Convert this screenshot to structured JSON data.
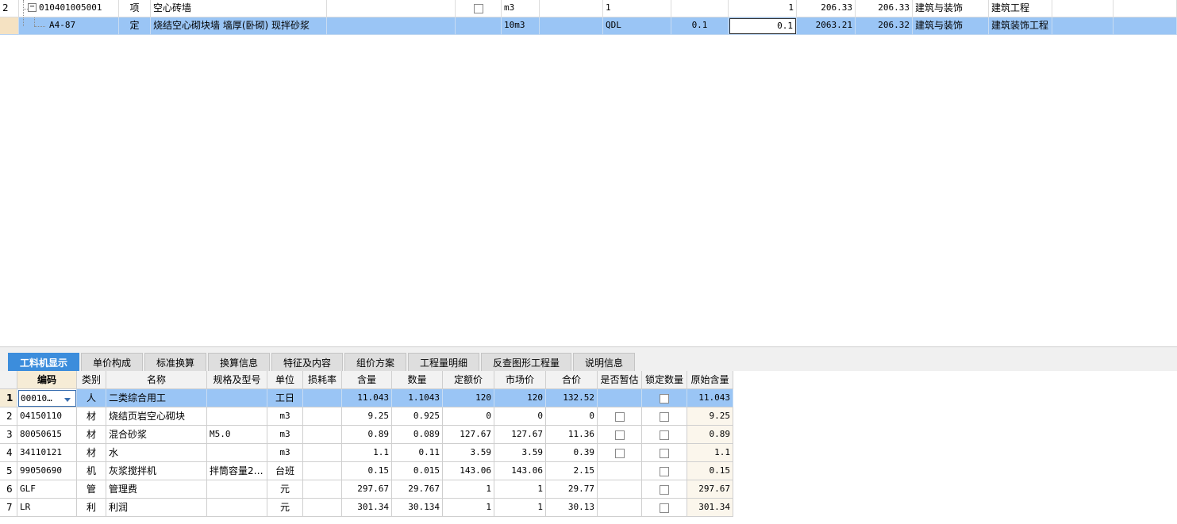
{
  "top_rows": [
    {
      "num": "2",
      "expand_sym": "−",
      "code": "010401005001",
      "type": "项",
      "name": "空心砖墙",
      "spec": "",
      "unit": "m3",
      "qty_expr": "1",
      "rate": "",
      "quantity": "1",
      "price": "206.33",
      "total": "206.33",
      "profession": "建筑与装饰",
      "project": "建筑工程"
    },
    {
      "num": "",
      "code": "A4-87",
      "type": "定",
      "name": "烧结空心砌块墙 墙厚(卧砌) 现拌砂浆",
      "spec": "",
      "unit": "10m3",
      "qty_expr": "QDL",
      "rate": "0.1",
      "quantity": "0.1",
      "price": "2063.21",
      "total": "206.32",
      "profession": "建筑与装饰",
      "project": "建筑装饰工程"
    }
  ],
  "tabs": [
    "工料机显示",
    "单价构成",
    "标准换算",
    "换算信息",
    "特征及内容",
    "组价方案",
    "工程量明细",
    "反查图形工程量",
    "说明信息"
  ],
  "bottom_headers": [
    "",
    "编码",
    "类别",
    "名称",
    "规格及型号",
    "单位",
    "损耗率",
    "含量",
    "数量",
    "定额价",
    "市场价",
    "合价",
    "是否暂估",
    "锁定数量",
    "原始含量"
  ],
  "bottom_rows": [
    {
      "num": "1",
      "code": "00010…",
      "cat": "人",
      "name": "二类综合用工",
      "spec": "",
      "unit": "工日",
      "loss": "",
      "content": "11.043",
      "qty": "1.1043",
      "quota": "120",
      "market": "120",
      "total": "132.52",
      "est": false,
      "lock": true,
      "orig": "11.043"
    },
    {
      "num": "2",
      "code": "04150110",
      "cat": "材",
      "name": "烧结页岩空心砌块",
      "spec": "",
      "unit": "m3",
      "loss": "",
      "content": "9.25",
      "qty": "0.925",
      "quota": "0",
      "market": "0",
      "total": "0",
      "est": true,
      "lock": true,
      "orig": "9.25"
    },
    {
      "num": "3",
      "code": "80050615",
      "cat": "材",
      "name": "混合砂浆",
      "spec": "M5.0",
      "unit": "m3",
      "loss": "",
      "content": "0.89",
      "qty": "0.089",
      "quota": "127.67",
      "market": "127.67",
      "total": "11.36",
      "est": true,
      "lock": true,
      "orig": "0.89"
    },
    {
      "num": "4",
      "code": "34110121",
      "cat": "材",
      "name": "水",
      "spec": "",
      "unit": "m3",
      "loss": "",
      "content": "1.1",
      "qty": "0.11",
      "quota": "3.59",
      "market": "3.59",
      "total": "0.39",
      "est": true,
      "lock": true,
      "orig": "1.1"
    },
    {
      "num": "5",
      "code": "99050690",
      "cat": "机",
      "name": "灰浆搅拌机",
      "spec": "拌筒容量2…",
      "unit": "台班",
      "loss": "",
      "content": "0.15",
      "qty": "0.015",
      "quota": "143.06",
      "market": "143.06",
      "total": "2.15",
      "est": false,
      "lock": true,
      "orig": "0.15"
    },
    {
      "num": "6",
      "code": "GLF",
      "cat": "管",
      "name": "管理费",
      "spec": "",
      "unit": "元",
      "loss": "",
      "content": "297.67",
      "qty": "29.767",
      "quota": "1",
      "market": "1",
      "total": "29.77",
      "est": false,
      "lock": true,
      "orig": "297.67"
    },
    {
      "num": "7",
      "code": "LR",
      "cat": "利",
      "name": "利润",
      "spec": "",
      "unit": "元",
      "loss": "",
      "content": "301.34",
      "qty": "30.134",
      "quota": "1",
      "market": "1",
      "total": "30.13",
      "est": false,
      "lock": true,
      "orig": "301.34"
    }
  ]
}
